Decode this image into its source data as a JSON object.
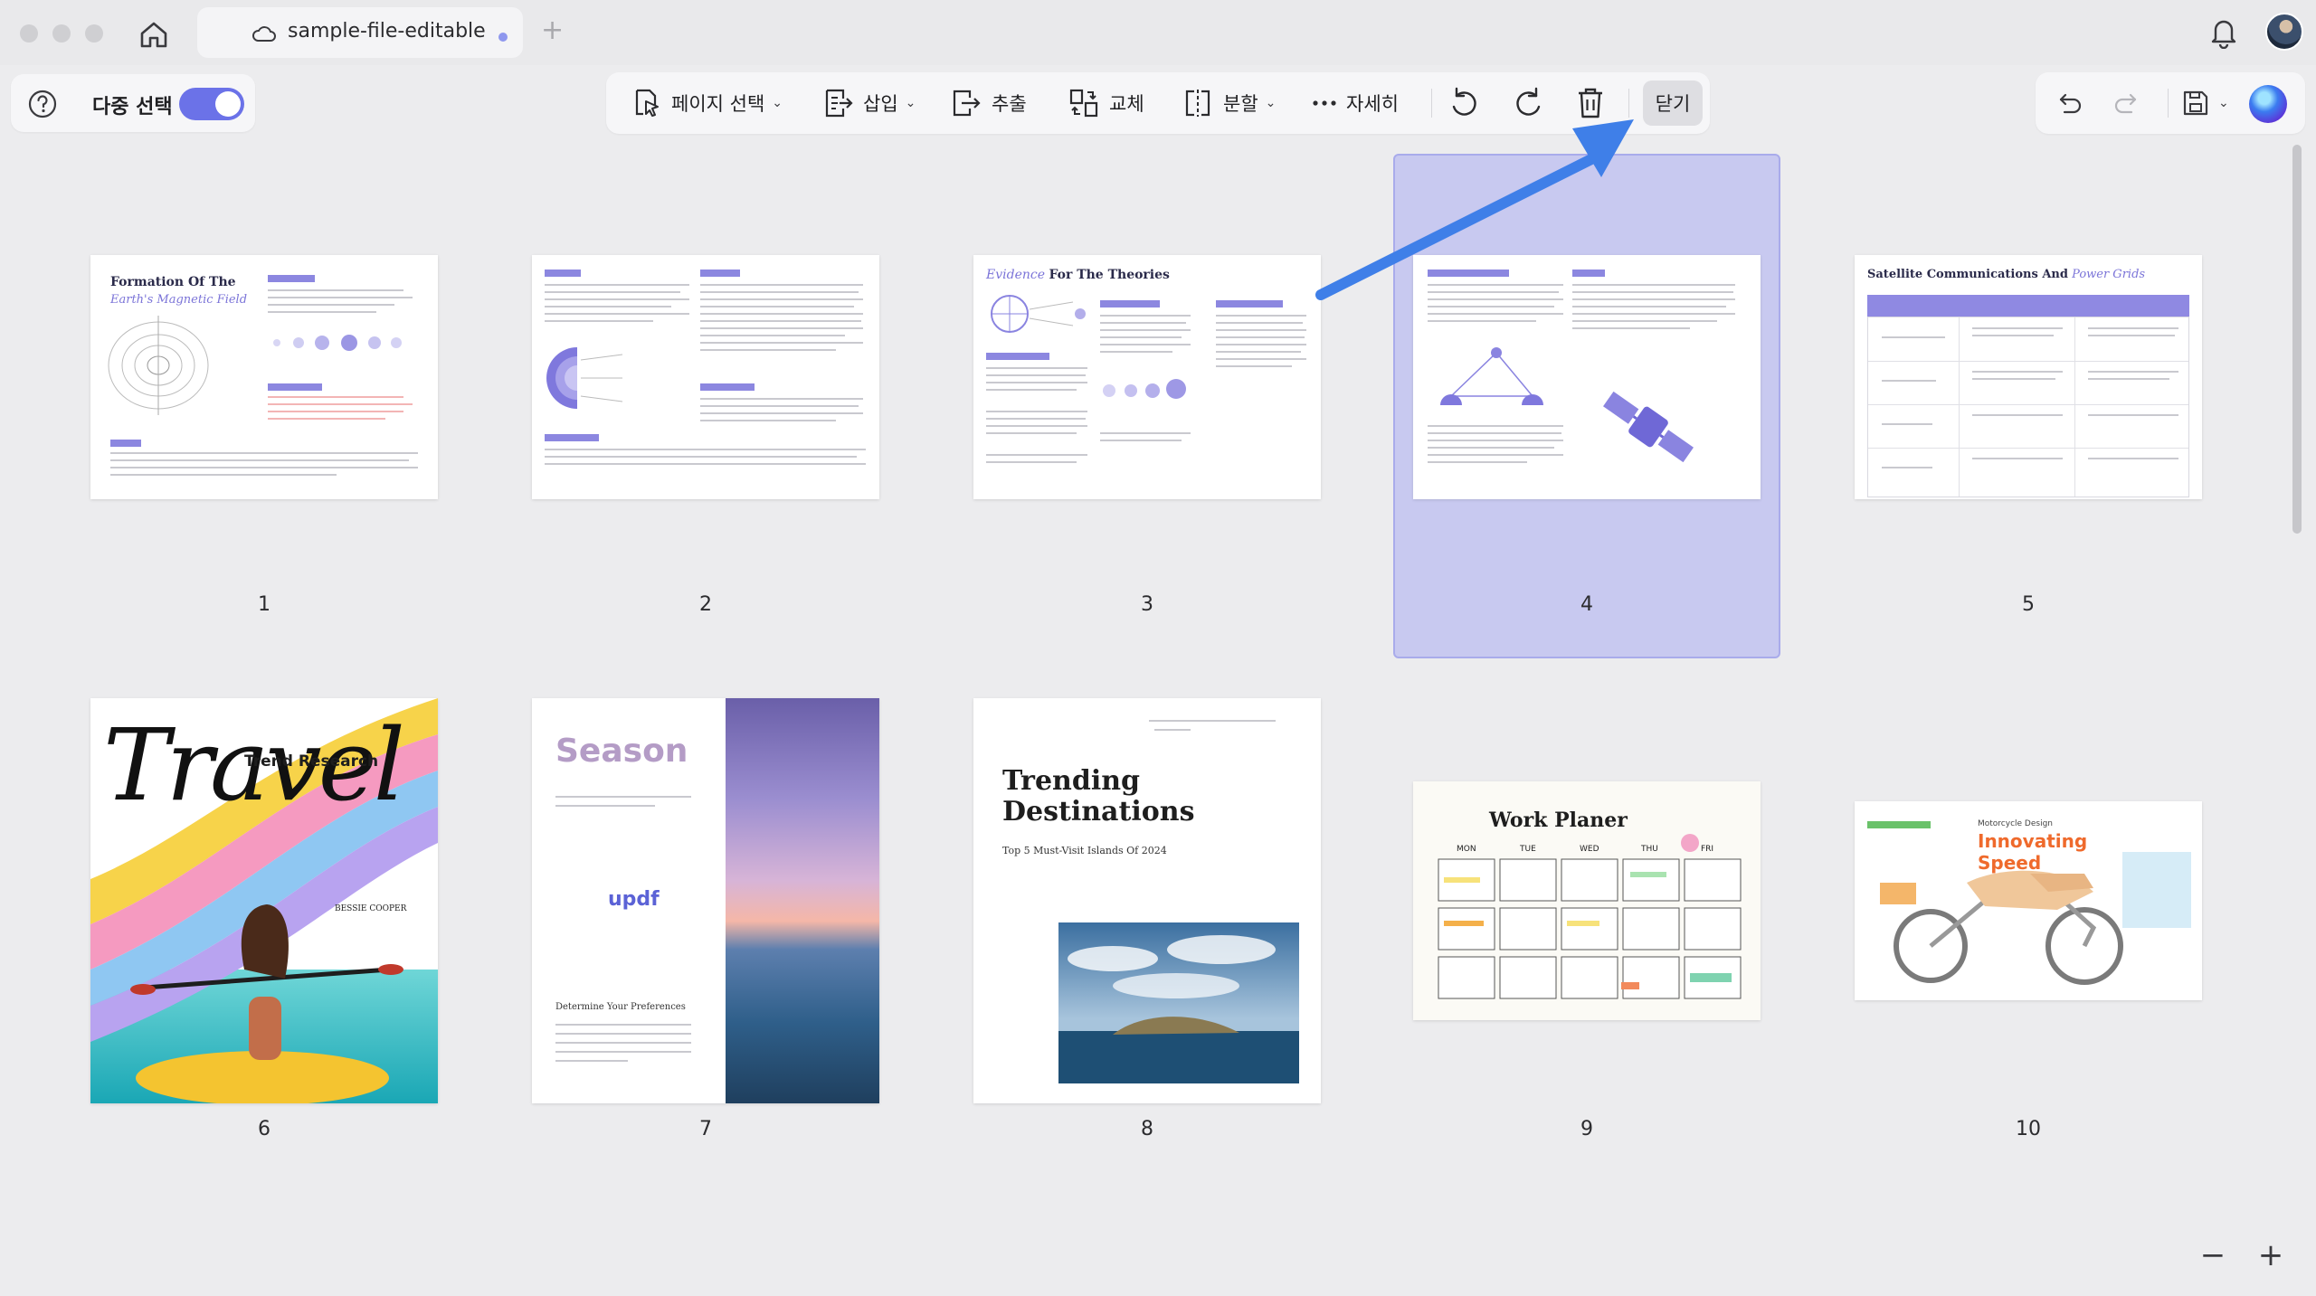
{
  "window": {
    "tab_title": "sample-file-editable",
    "new_tab_symbol": "+"
  },
  "toolbar_left": {
    "multi_select_label": "다중 선택",
    "multi_select_on": true
  },
  "toolbar_main": {
    "page_select_label": "페이지 선택",
    "insert_label": "삽입",
    "extract_label": "추출",
    "replace_label": "교체",
    "split_label": "분할",
    "more_label": "자세히",
    "close_label": "닫기"
  },
  "colors": {
    "accent": "#6b72e8",
    "arrow": "#3f7fe8",
    "selection": "#c8c9f0"
  },
  "pages": [
    {
      "number": "1",
      "selected": false,
      "title": "Formation Of The",
      "subtitle": "Earth's Magnetic Field"
    },
    {
      "number": "2",
      "selected": false
    },
    {
      "number": "3",
      "selected": false,
      "title_plain": "Evidence",
      "title_rest": "For The Theories"
    },
    {
      "number": "4",
      "selected": true
    },
    {
      "number": "5",
      "selected": false,
      "title_plain": "Satellite Communications And",
      "title_rest": "Power Grids"
    },
    {
      "number": "6",
      "selected": false,
      "big_word": "Travel",
      "tag": "Trend Research",
      "author": "BESSIE COOPER"
    },
    {
      "number": "7",
      "selected": false,
      "title": "Season",
      "brand": "updf",
      "subhead": "Determine Your Preferences"
    },
    {
      "number": "8",
      "selected": false,
      "title_line1": "Trending",
      "title_line2": "Destinations",
      "subtitle": "Top 5 Must-Visit Islands Of 2024"
    },
    {
      "number": "9",
      "selected": false,
      "title": "Work Planer",
      "days": [
        "MON",
        "TUE",
        "WED",
        "THU",
        "FRI"
      ]
    },
    {
      "number": "10",
      "selected": false,
      "title_line1": "Innovating",
      "title_line2": "Speed",
      "kicker": "Motorcycle Design"
    }
  ],
  "zoom": {
    "minus": "−",
    "plus": "+"
  },
  "icons": [
    "home-icon",
    "cloud-icon",
    "bell-icon",
    "help-icon",
    "page-select-icon",
    "insert-icon",
    "extract-icon",
    "replace-icon",
    "split-icon",
    "more-icon",
    "rotate-left-icon",
    "rotate-right-icon",
    "trash-icon",
    "undo-icon",
    "redo-icon",
    "save-icon",
    "ai-assistant-icon"
  ]
}
